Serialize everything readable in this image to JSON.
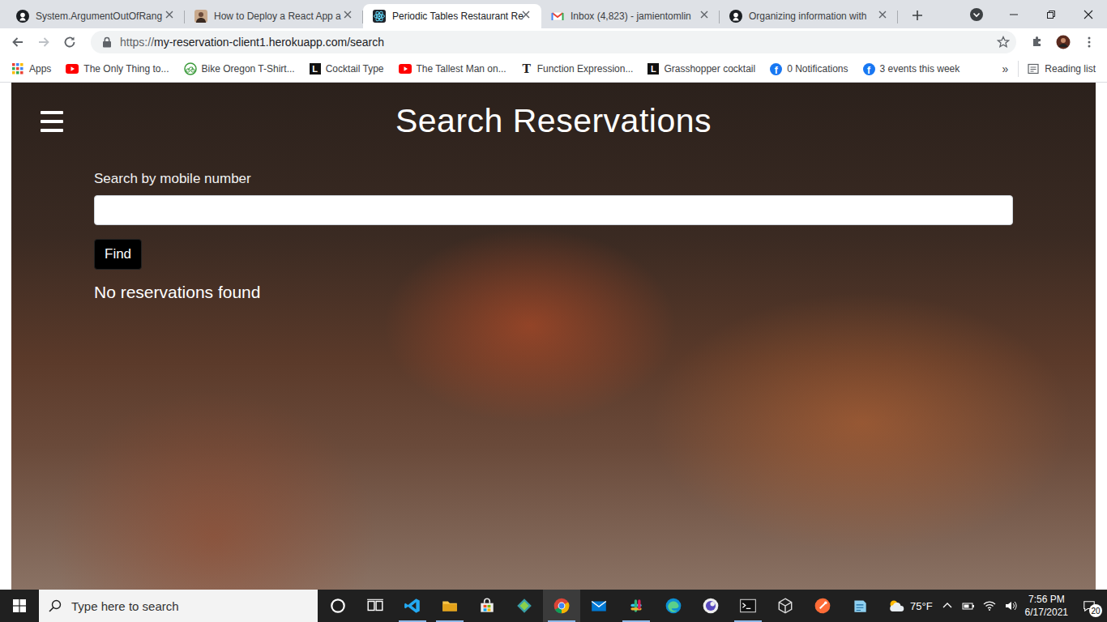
{
  "tabs": [
    {
      "label": "System.ArgumentOutOfRang",
      "selected": false,
      "kind": "github"
    },
    {
      "label": "How to Deploy a React App a",
      "selected": false,
      "kind": "avatar"
    },
    {
      "label": "Periodic Tables Restaurant Re",
      "selected": true,
      "kind": "react"
    },
    {
      "label": "Inbox (4,823) - jamientomlin",
      "selected": false,
      "kind": "gmail"
    },
    {
      "label": "Organizing information with",
      "selected": false,
      "kind": "github"
    }
  ],
  "address_bar": {
    "scheme": "https://",
    "url": "my-reservation-client1.herokuapp.com/search"
  },
  "bookmarks": [
    {
      "label": "Apps",
      "kind": "apps"
    },
    {
      "label": "The Only Thing to...",
      "kind": "youtube"
    },
    {
      "label": "Bike Oregon T-Shirt...",
      "kind": "bike"
    },
    {
      "label": "Cocktail Type",
      "kind": "letter",
      "icon_text": "L"
    },
    {
      "label": "The Tallest Man on...",
      "kind": "youtube"
    },
    {
      "label": "Function Expression...",
      "kind": "glyph",
      "icon_text": "T"
    },
    {
      "label": "Grasshopper cocktail",
      "kind": "letter",
      "icon_text": "L"
    },
    {
      "label": "0 Notifications",
      "kind": "facebook",
      "icon_text": "f"
    },
    {
      "label": "3 events this week",
      "kind": "facebook",
      "icon_text": "f"
    }
  ],
  "bookmarks_overflow": "»",
  "reading_list": "Reading list",
  "page": {
    "title": "Search Reservations",
    "search_label": "Search by mobile number",
    "search_value": "",
    "find_button": "Find",
    "result_message": "No reservations found"
  },
  "taskbar": {
    "search_placeholder": "Type here to search",
    "apps": [
      {
        "kind": "cortana",
        "running": false,
        "selected": false
      },
      {
        "kind": "taskview",
        "running": false,
        "selected": false
      },
      {
        "kind": "vscode",
        "running": true,
        "selected": false
      },
      {
        "kind": "explorer",
        "running": true,
        "selected": false
      },
      {
        "kind": "store",
        "running": false,
        "selected": false
      },
      {
        "kind": "gitkraken",
        "running": false,
        "selected": false
      },
      {
        "kind": "chrome",
        "running": true,
        "selected": true
      },
      {
        "kind": "mail",
        "running": false,
        "selected": false
      },
      {
        "kind": "slack",
        "running": true,
        "selected": false
      },
      {
        "kind": "edge",
        "running": false,
        "selected": false
      },
      {
        "kind": "insomnia",
        "running": false,
        "selected": false
      },
      {
        "kind": "terminal",
        "running": true,
        "selected": false
      },
      {
        "kind": "3d",
        "running": false,
        "selected": false
      },
      {
        "kind": "postman",
        "running": false,
        "selected": false
      },
      {
        "kind": "notepad",
        "running": false,
        "selected": false
      }
    ],
    "weather": "75°F",
    "time": "7:56 PM",
    "date": "6/17/2021",
    "notification_count": "20"
  }
}
